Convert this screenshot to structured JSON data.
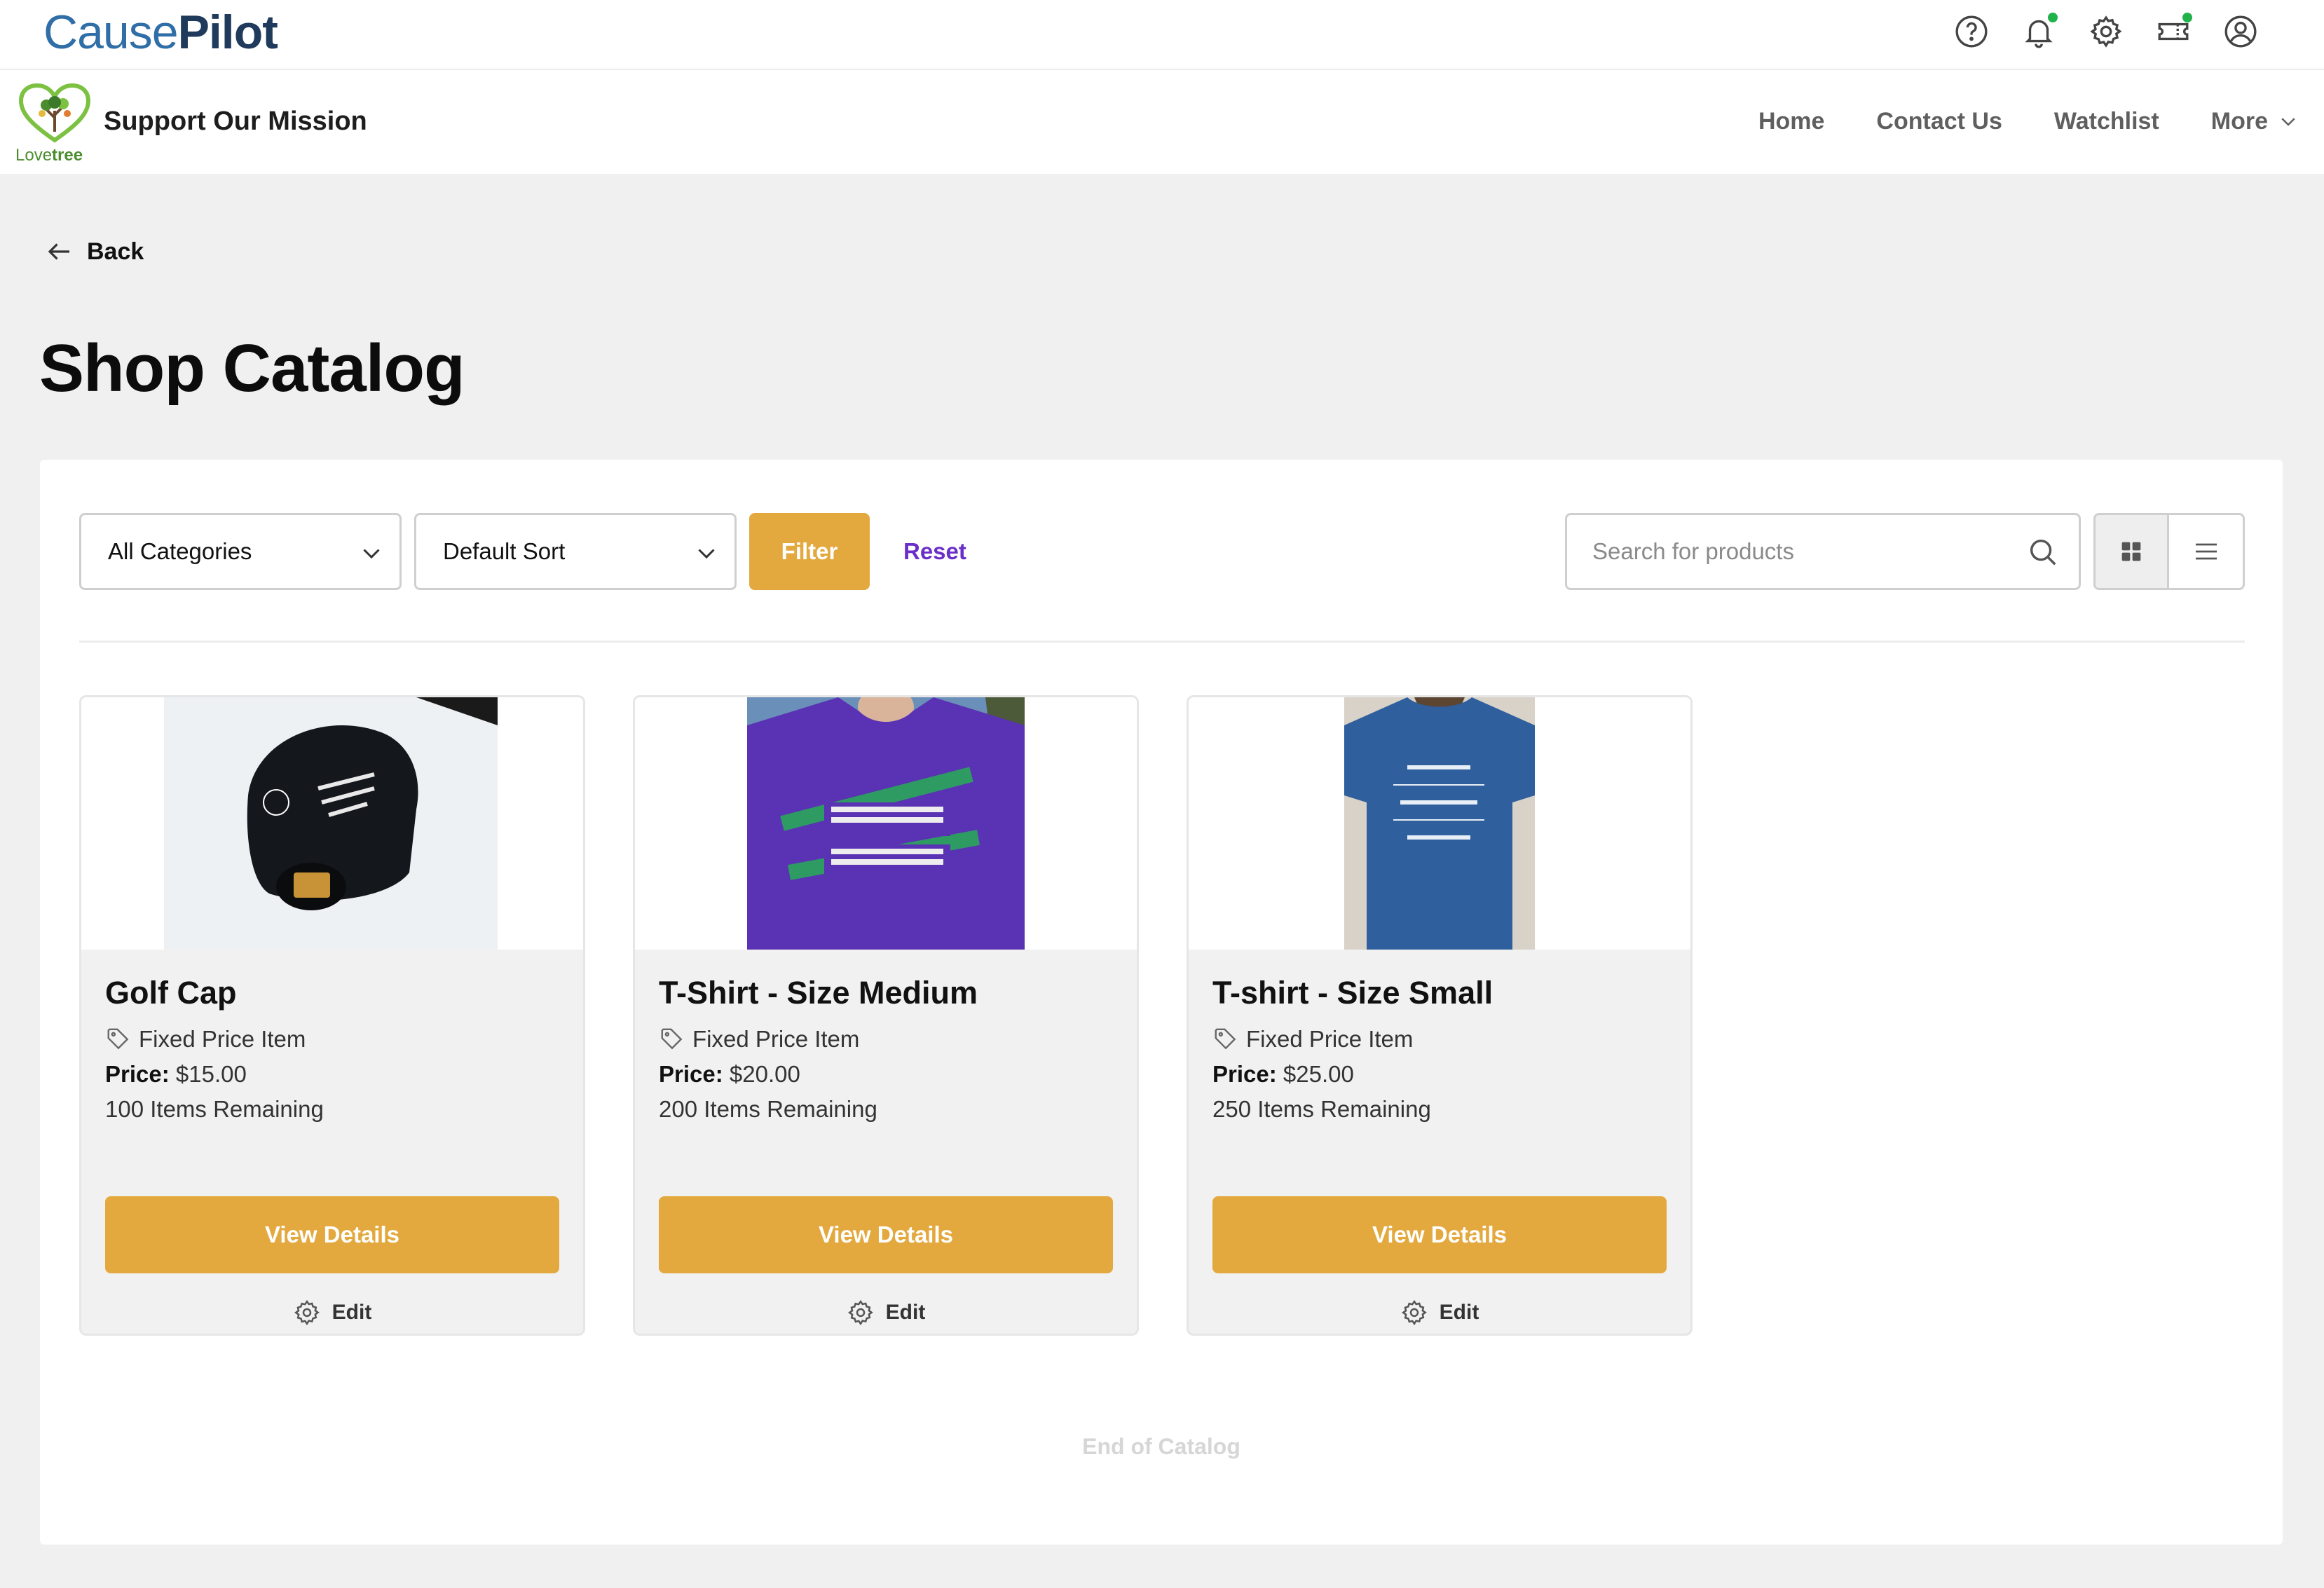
{
  "app": {
    "brand_cause": "Cause",
    "brand_pilot": "Pilot",
    "top_icons": [
      "help-icon",
      "bell-icon",
      "gear-icon",
      "ticket-icon",
      "user-icon"
    ]
  },
  "org": {
    "logo_love": "Love",
    "logo_tree": "tree",
    "title": "Support Our Mission",
    "nav": [
      "Home",
      "Contact Us",
      "Watchlist",
      "More"
    ]
  },
  "page": {
    "back_label": "Back",
    "title": "Shop Catalog"
  },
  "filters": {
    "category_value": "All Categories",
    "sort_value": "Default Sort",
    "filter_label": "Filter",
    "reset_label": "Reset",
    "search_placeholder": "Search for products"
  },
  "products": [
    {
      "name": "Golf Cap",
      "type": "Fixed Price Item",
      "price_label": "Price:",
      "price": "$15.00",
      "remaining": "100 Items Remaining",
      "view_label": "View Details",
      "edit_label": "Edit"
    },
    {
      "name": "T-Shirt - Size Medium",
      "type": "Fixed Price Item",
      "price_label": "Price:",
      "price": "$20.00",
      "remaining": "200 Items Remaining",
      "view_label": "View Details",
      "edit_label": "Edit"
    },
    {
      "name": "T-shirt - Size Small",
      "type": "Fixed Price Item",
      "price_label": "Price:",
      "price": "$25.00",
      "remaining": "250 Items Remaining",
      "view_label": "View Details",
      "edit_label": "Edit"
    }
  ],
  "footer": {
    "end_label": "End of Catalog"
  },
  "colors": {
    "accent": "#e3a93e",
    "reset": "#6a2fc9",
    "brand_blue": "#2f6ea6",
    "notification_dot": "#22b24c"
  }
}
